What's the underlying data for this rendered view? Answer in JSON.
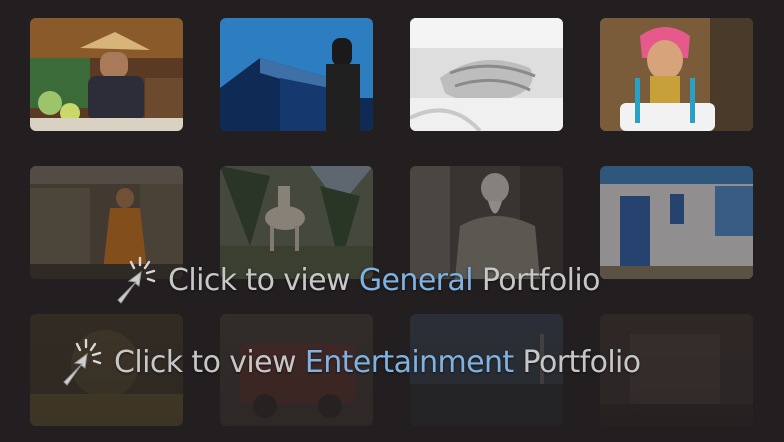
{
  "colors": {
    "background": "#231f20",
    "link_text": "#c7c7c7",
    "link_highlight": "#7fb2e0"
  },
  "gallery": {
    "rows": [
      {
        "items": [
          {
            "subject": "floating-market-vendor"
          },
          {
            "subject": "building-with-photographer"
          },
          {
            "subject": "bridal-hands"
          },
          {
            "subject": "long-neck-woman"
          }
        ]
      },
      {
        "items": [
          {
            "subject": "temple-monk"
          },
          {
            "subject": "white-goat"
          },
          {
            "subject": "old-man-bench"
          },
          {
            "subject": "white-house-blue-door"
          }
        ]
      },
      {
        "items": [
          {
            "subject": "dim-portrait"
          },
          {
            "subject": "dim-vehicle"
          },
          {
            "subject": "dim-harbor"
          },
          {
            "subject": "dim-interior"
          }
        ]
      }
    ]
  },
  "links": {
    "general": {
      "prefix": "Click to view ",
      "highlight": "General",
      "suffix": " Portfolio",
      "icon": "click-cursor-icon"
    },
    "entertainment": {
      "prefix": "Click to view ",
      "highlight": "Entertainment",
      "suffix": " Portfolio",
      "icon": "click-cursor-icon"
    }
  }
}
